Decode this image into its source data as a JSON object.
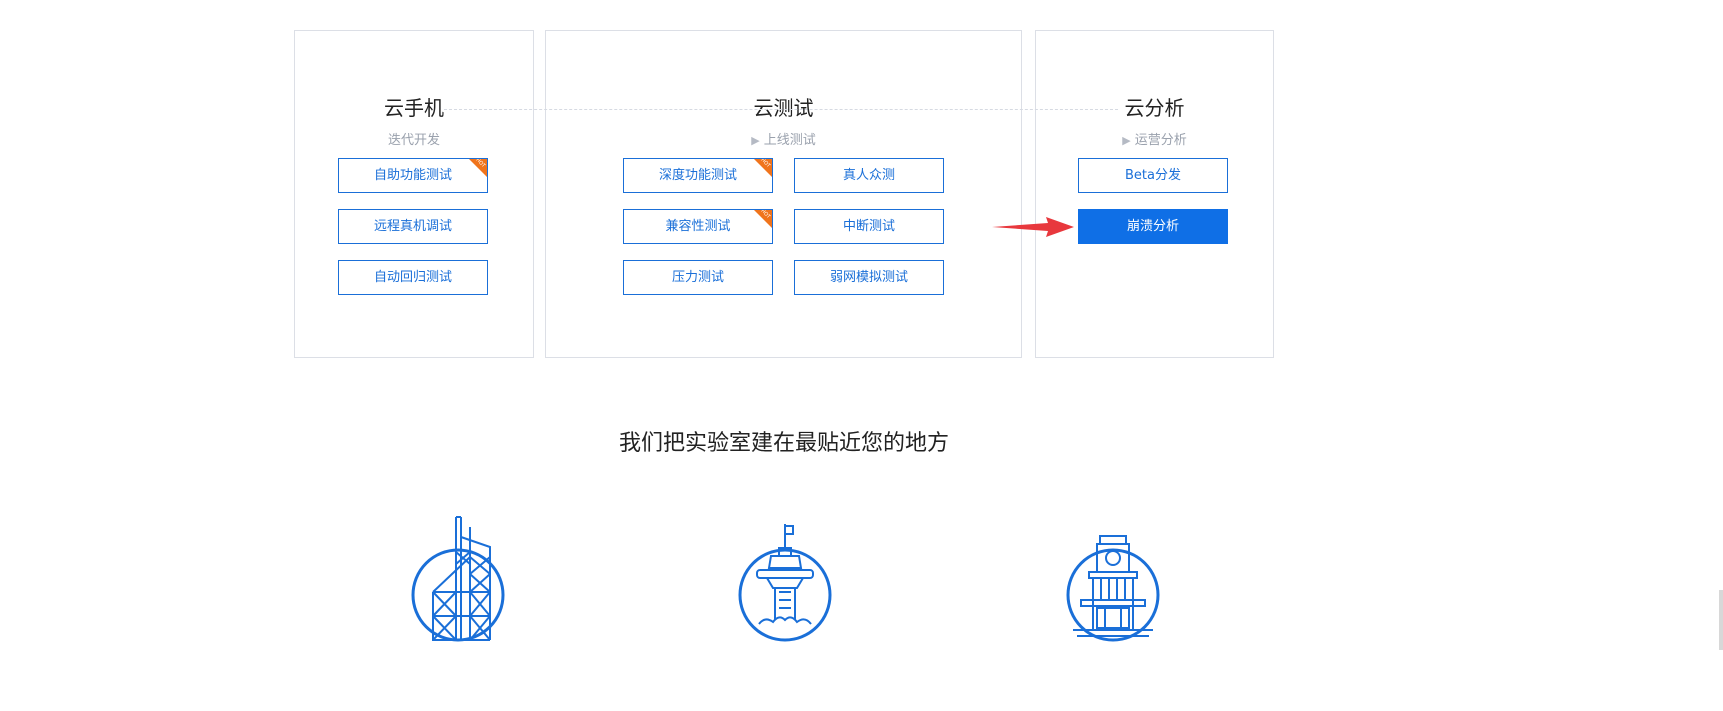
{
  "panels": [
    {
      "title": "云手机",
      "subtitle": "迭代开发",
      "buttons": [
        {
          "label": "自助功能测试",
          "hot": true
        },
        {
          "label": "远程真机调试",
          "hot": false
        },
        {
          "label": "自动回归测试",
          "hot": false
        }
      ]
    },
    {
      "title": "云测试",
      "subtitle": "上线测试",
      "buttons": [
        {
          "label": "深度功能测试",
          "hot": true
        },
        {
          "label": "真人众测",
          "hot": false
        },
        {
          "label": "兼容性测试",
          "hot": true
        },
        {
          "label": "中断测试",
          "hot": false
        },
        {
          "label": "压力测试",
          "hot": false
        },
        {
          "label": "弱网模拟测试",
          "hot": false
        }
      ]
    },
    {
      "title": "云分析",
      "subtitle": "运营分析",
      "buttons": [
        {
          "label": "Beta分发",
          "hot": false
        },
        {
          "label": "崩溃分析",
          "hot": false,
          "active": true
        }
      ]
    }
  ],
  "hot_badge": "HOT",
  "section_title": "我们把实验室建在最贴近您的地方",
  "landmark_icons": [
    "hong-kong-tower-icon",
    "airport-tower-icon",
    "clock-building-icon"
  ],
  "colors": {
    "accent": "#0f6fe6",
    "button_border": "#1a6fd8",
    "hot": "#f0741c",
    "arrow": "#e8383d",
    "subtitle": "#9aa1ad"
  }
}
